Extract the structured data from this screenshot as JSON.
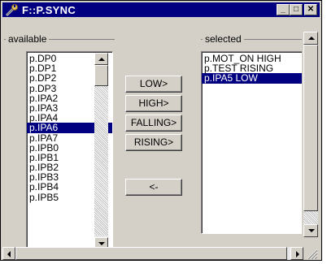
{
  "window": {
    "title": "F::P.SYNC"
  },
  "titlebar_buttons": {
    "minimize": "_",
    "maximize": "□",
    "close": "✕"
  },
  "available": {
    "label": "available",
    "items": [
      "p.DP0",
      "p.DP1",
      "p.DP2",
      "p.DP3",
      "p.IPA2",
      "p.IPA3",
      "p.IPA4",
      "p.IPA6",
      "p.IPA7",
      "p.IPB0",
      "p.IPB1",
      "p.IPB2",
      "p.IPB3",
      "p.IPB4",
      "p.IPB5"
    ],
    "selected_item": "p.IPA6"
  },
  "selected": {
    "label": "selected",
    "items": [
      "p.MOT_ON HIGH",
      "p.TEST RISING",
      "p.IPA5 LOW"
    ],
    "selected_item": "p.IPA5 LOW"
  },
  "buttons": {
    "low": "LOW>",
    "high": "HIGH>",
    "falling": "FALLING>",
    "rising": "RISING>",
    "remove": "<-"
  },
  "colors": {
    "selection": "#000080",
    "titlebar": "#000080",
    "face": "#d4d0c8"
  }
}
